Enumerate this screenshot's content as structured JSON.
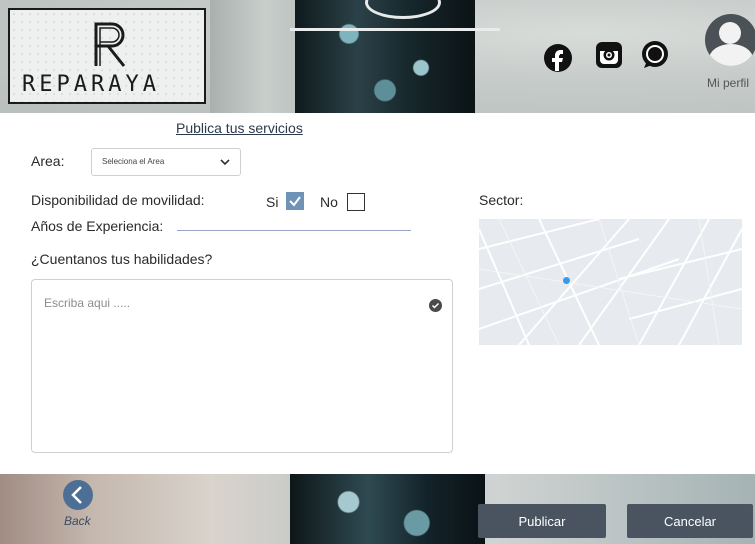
{
  "header": {
    "logo_text": "REPARAYA",
    "social": [
      "facebook-icon",
      "instagram-icon",
      "whatsapp-icon"
    ],
    "profile_label": "Mi perfil"
  },
  "form": {
    "title": "Publica tus servicios",
    "area_label": "Area:",
    "area_select_value": "Seleciona el Area",
    "mobility_label": "Disponibilidad de movilidad:",
    "yes_label": "Si",
    "yes_checked": true,
    "no_label": "No",
    "no_checked": false,
    "experience_label": "Años de Experiencia:",
    "experience_value": "",
    "skills_label": "¿Cuentanos tus habilidades?",
    "skills_placeholder": "Escriba aqui .....",
    "sector_label": "Sector:"
  },
  "footer": {
    "back_label": "Back",
    "publish_label": "Publicar",
    "cancel_label": "Cancelar"
  },
  "colors": {
    "button": "#4a5460",
    "checkbox_checked": "#6f93b7",
    "back_button": "#4d6f95",
    "map_pin": "#3a9ae8"
  }
}
